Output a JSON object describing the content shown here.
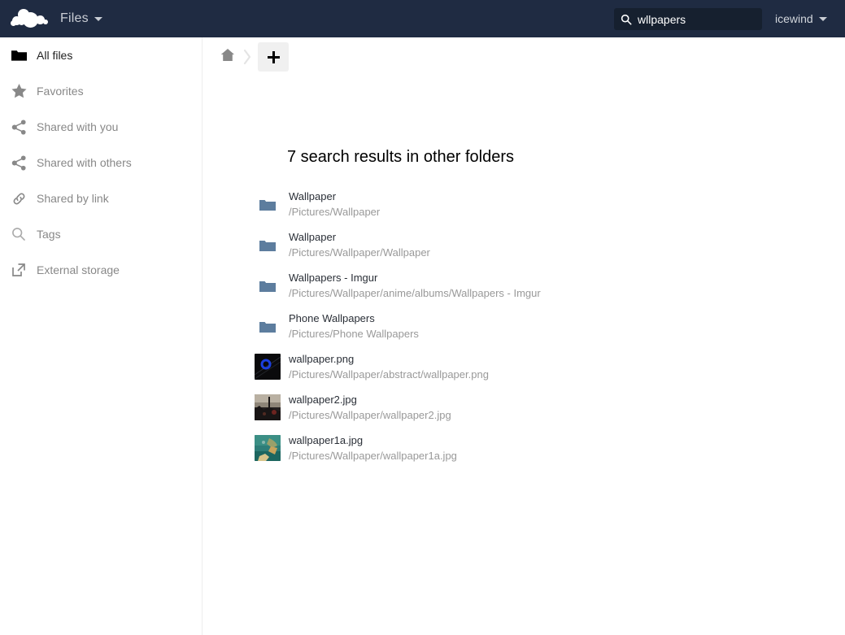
{
  "header": {
    "logo_name": "owncloud-cloud-logo",
    "app_name": "Files",
    "search": {
      "value": "wllpapers",
      "placeholder": "Search",
      "icon": "search-icon"
    },
    "user": {
      "name": "icewind",
      "caret_icon": "chevron-down-icon"
    },
    "background_color": "#1f2b42"
  },
  "sidebar": {
    "items": [
      {
        "label": "All files",
        "icon": "folder-icon",
        "active": true
      },
      {
        "label": "Favorites",
        "icon": "star-icon",
        "active": false
      },
      {
        "label": "Shared with you",
        "icon": "share-icon",
        "active": false
      },
      {
        "label": "Shared with others",
        "icon": "share-icon",
        "active": false
      },
      {
        "label": "Shared by link",
        "icon": "link-icon",
        "active": false
      },
      {
        "label": "Tags",
        "icon": "magnifier-icon",
        "active": false
      },
      {
        "label": "External storage",
        "icon": "external-link-icon",
        "active": false
      }
    ]
  },
  "breadcrumb": {
    "home_icon": "home-icon",
    "separator_icon": "chevron-right-icon",
    "new_button_label": "+",
    "new_button_icon": "plus-icon"
  },
  "main": {
    "results_heading": "7 search results in other folders",
    "results": [
      {
        "name": "Wallpaper",
        "path": "/Pictures/Wallpaper",
        "kind": "folder"
      },
      {
        "name": "Wallpaper",
        "path": "/Pictures/Wallpaper/Wallpaper",
        "kind": "folder"
      },
      {
        "name": "Wallpapers - Imgur",
        "path": "/Pictures/Wallpaper/anime/albums/Wallpapers - Imgur",
        "kind": "folder"
      },
      {
        "name": "Phone Wallpapers",
        "path": "/Pictures/Phone Wallpapers",
        "kind": "folder"
      },
      {
        "name": "wallpaper.png",
        "path": "/Pictures/Wallpaper/abstract/wallpaper.png",
        "kind": "image-dark-blue-ring"
      },
      {
        "name": "wallpaper2.jpg",
        "path": "/Pictures/Wallpaper/wallpaper2.jpg",
        "kind": "image-dusk-scene"
      },
      {
        "name": "wallpaper1a.jpg",
        "path": "/Pictures/Wallpaper/wallpaper1a.jpg",
        "kind": "image-teal-landscape"
      }
    ]
  },
  "colors": {
    "header_navy": "#1f2b42",
    "search_field": "#16202f",
    "folder_blue": "#5d7d9e",
    "text_dark": "#2a2f37",
    "text_muted": "#999999",
    "sidebar_text": "#888888",
    "button_gray": "#f0f0f0"
  }
}
